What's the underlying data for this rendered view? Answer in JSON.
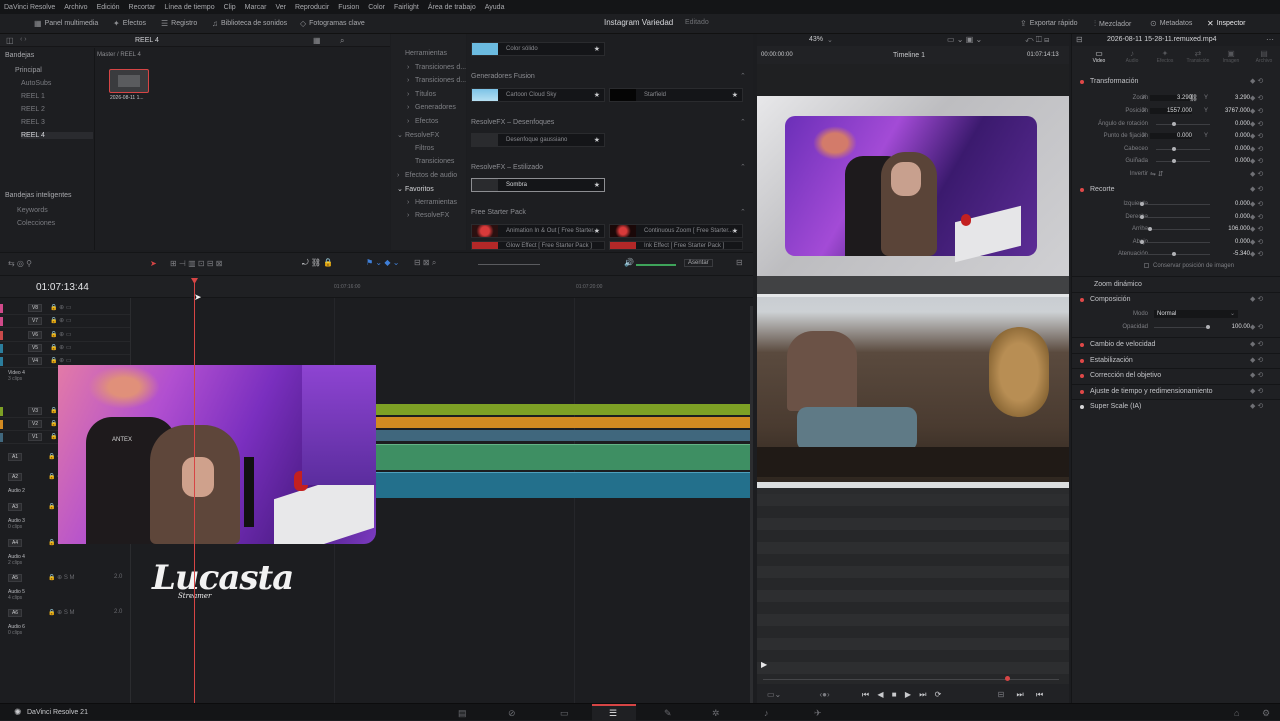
{
  "menu": [
    "DaVinci Resolve",
    "Archivo",
    "Edición",
    "Recortar",
    "Línea de tiempo",
    "Clip",
    "Marcar",
    "Ver",
    "Reproducir",
    "Fusion",
    "Color",
    "Fairlight",
    "Área de trabajo",
    "Ayuda"
  ],
  "toolbar": {
    "left": [
      {
        "label": "Panel multimedia",
        "icon": "media-pool-icon"
      },
      {
        "label": "Efectos",
        "icon": "effects-icon"
      },
      {
        "label": "Registro",
        "icon": "index-icon"
      },
      {
        "label": "Biblioteca de sonidos",
        "icon": "sound-library-icon"
      },
      {
        "label": "Fotogramas clave",
        "icon": "keyframes-icon"
      }
    ],
    "project_title": "Instagram Variedad",
    "project_status": "Editado",
    "right": [
      {
        "label": "Exportar rápido",
        "icon": "quick-export-icon"
      },
      {
        "label": "Mezclador",
        "icon": "mixer-icon"
      },
      {
        "label": "Metadatos",
        "icon": "metadata-icon"
      },
      {
        "label": "Inspector",
        "icon": "inspector-icon"
      }
    ]
  },
  "media_pool": {
    "bin_name": "REEL 4",
    "path": "Master / REEL 4",
    "bins_title": "Bandejas",
    "bins": [
      "Principal",
      "AutoSubs",
      "REEL 1",
      "REEL 2",
      "REEL 3",
      "REEL 4"
    ],
    "smart_bins_title": "Bandejas inteligentes",
    "smart_bins": [
      "Keywords",
      "Colecciones"
    ],
    "clip_name": "2026-08-11 1..."
  },
  "effects_tree": [
    "Herramientas",
    "Transiciones d...",
    "Transiciones d...",
    "Títulos",
    "Generadores",
    "Efectos",
    "ResolveFX",
    "Filtros",
    "Transiciones",
    "Efectos de audio",
    "Favoritos",
    "Herramientas",
    "ResolveFX"
  ],
  "effects": {
    "top_card": "Color sólido",
    "sections": [
      {
        "title": "Generadores Fusion",
        "cards": [
          "Cartoon Cloud Sky",
          "Starfield"
        ]
      },
      {
        "title": "ResolveFX – Desenfoques",
        "cards": [
          "Desenfoque gaussiano"
        ]
      },
      {
        "title": "ResolveFX – Estilizado",
        "cards": [
          "Sombra"
        ]
      },
      {
        "title": "Free Starter Pack",
        "cards": [
          "Animation In & Out [ Free Starter...",
          "Continuous Zoom [ Free Starter...",
          "Glow Effect [ Free Starter Pack ]",
          "Ink Effect [ Free Starter Pack ]"
        ]
      }
    ]
  },
  "timeline": {
    "timecode": "01:07:13:44",
    "ruler_marks": [
      "01:07:16:00",
      "01:07:20:00"
    ],
    "snap_label": "Asentar",
    "video_tracks": [
      "V8",
      "V7",
      "V6",
      "V5",
      "V4",
      "V3",
      "V2",
      "V1"
    ],
    "audio_tracks": [
      "A1",
      "A2",
      "A3",
      "A4",
      "A5",
      "A6"
    ],
    "track_names": [
      {
        "name": "Video 4",
        "clips": "3 clips"
      },
      {
        "name": "Audio 2",
        "clips": ""
      },
      {
        "name": "Audio 3",
        "clips": "0 clips"
      },
      {
        "name": "Audio 4",
        "clips": "2 clips"
      },
      {
        "name": "Audio 5",
        "clips": "4 clips"
      },
      {
        "name": "Audio 6",
        "clips": "0 clips"
      }
    ],
    "audio_level": "2.0",
    "watermark": "Lucasta",
    "watermark_sub": "Streamer"
  },
  "viewer": {
    "zoom": "43%",
    "timeline_name": "Timeline 1",
    "tc_left": "00:00:00:00",
    "tc_right": "01:07:14:13"
  },
  "inspector": {
    "clip_name": "2026-08-11 15-28-11.remuxed.mp4",
    "tabs": [
      "Video",
      "Audio",
      "Efectos",
      "Transición",
      "Imagen",
      "Archivo"
    ],
    "transform_title": "Transformación",
    "transform": [
      {
        "label": "Zoom",
        "x": "3.290",
        "y": "3.290"
      },
      {
        "label": "Posición",
        "x": "1557.000",
        "y": "3767.000"
      },
      {
        "label": "Ángulo de rotación",
        "v": "0.000"
      },
      {
        "label": "Punto de fijación",
        "x": "0.000",
        "y": "0.000"
      },
      {
        "label": "Cabeceo",
        "v": "0.000"
      },
      {
        "label": "Guiñada",
        "v": "0.000"
      },
      {
        "label": "Invertir",
        "v": ""
      }
    ],
    "crop_title": "Recorte",
    "crop": [
      {
        "label": "Izquierda",
        "v": "0.000"
      },
      {
        "label": "Derecha",
        "v": "0.000"
      },
      {
        "label": "Arriba",
        "v": "106.000"
      },
      {
        "label": "Abajo",
        "v": "0.000"
      },
      {
        "label": "Atenuación",
        "v": "-5.340"
      }
    ],
    "retain_label": "Conservar posición de imagen",
    "dynamic_zoom": "Zoom dinámico",
    "composite_title": "Composición",
    "mode_label": "Modo",
    "mode_value": "Normal",
    "opacity_label": "Opacidad",
    "opacity_value": "100.00",
    "sections": [
      "Cambio de velocidad",
      "Estabilización",
      "Corrección del objetivo",
      "Ajuste de tiempo y redimensionamiento",
      "Super Scale (IA)"
    ]
  },
  "footer": {
    "app": "DaVinci Resolve 21"
  }
}
